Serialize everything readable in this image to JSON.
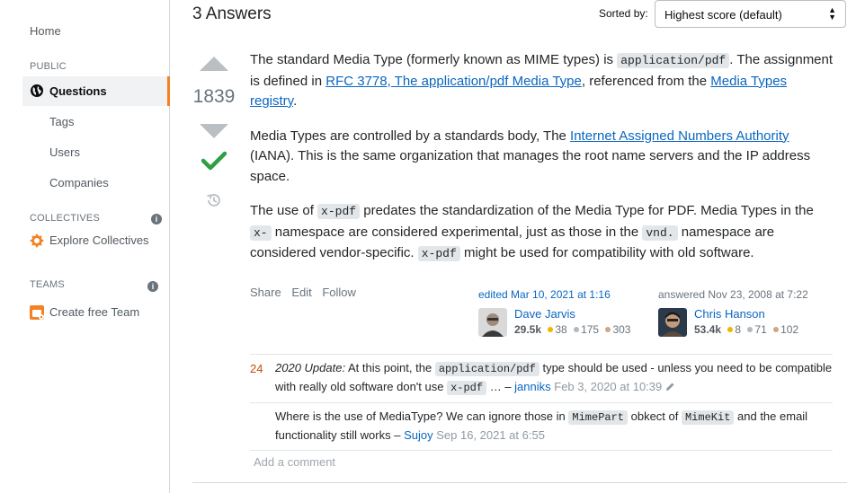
{
  "sidebar": {
    "home": "Home",
    "public_label": "PUBLIC",
    "questions": "Questions",
    "tags": "Tags",
    "users": "Users",
    "companies": "Companies",
    "collectives_label": "COLLECTIVES",
    "explore_collectives": "Explore Collectives",
    "teams_label": "TEAMS",
    "create_team": "Create free Team",
    "info_glyph": "i"
  },
  "header": {
    "answers_count": "3 Answers",
    "sorted_by_label": "Sorted by:",
    "sort_value": "Highest score (default)"
  },
  "answer": {
    "vote_count": "1839",
    "p1": {
      "t1": "The standard Media Type (formerly known as MIME types) is ",
      "code1": "application/pdf",
      "t2": ". The assignment is defined in ",
      "link1": "RFC 3778, The application/pdf Media Type",
      "t3": ", referenced from the ",
      "link2": "Media Types registry",
      "t4": "."
    },
    "p2": {
      "t1": "Media Types are controlled by a standards body, The ",
      "link1": "Internet Assigned Numbers Authority",
      "t2": " (IANA). This is the same organization that manages the root name servers and the IP address space."
    },
    "p3": {
      "t1": "The use of ",
      "code1": "x-pdf",
      "t2": " predates the standardization of the Media Type for PDF. Media Types in the ",
      "code2": "x-",
      "t3": " namespace are considered experimental, just as those in the ",
      "code3": "vnd.",
      "t4": " namespace are considered vendor-specific. ",
      "code4": "x-pdf",
      "t5": " might be used for compatibility with old software."
    },
    "menu": {
      "share": "Share",
      "edit": "Edit",
      "follow": "Follow"
    },
    "editor": {
      "action": "edited Mar 10, 2021 at 1:16",
      "name": "Dave Jarvis",
      "rep": "29.5k",
      "gold": "38",
      "silver": "175",
      "bronze": "303"
    },
    "author": {
      "action": "answered Nov 23, 2008 at 7:22",
      "name": "Chris Hanson",
      "rep": "53.4k",
      "gold": "8",
      "silver": "71",
      "bronze": "102"
    }
  },
  "comments": [
    {
      "score": "24",
      "italic": "2020 Update:",
      "t1": " At this point, the ",
      "code1": "application/pdf",
      "t2": " type should be used - unless you need to be compatible with really old software don't use ",
      "code2": "x-pdf",
      "t3": " … – ",
      "user": "janniks",
      "date": "Feb 3, 2020 at 10:39"
    },
    {
      "t1": "Where is the use of MediaType? We can ignore those in ",
      "code1": "MimePart",
      "t2": " obkect of ",
      "code2": "MimeKit",
      "t3": " and the email functionality still works – ",
      "user": "Sujoy",
      "date": "Sep 16, 2021 at 6:55"
    }
  ],
  "add_comment": "Add a comment",
  "colors": {
    "accent_orange": "#f48225",
    "link_blue": "#0a66c2",
    "accepted_green": "#2f9e44",
    "gold": "#f1b600",
    "silver": "#b4b8bc",
    "bronze": "#d1a684"
  }
}
